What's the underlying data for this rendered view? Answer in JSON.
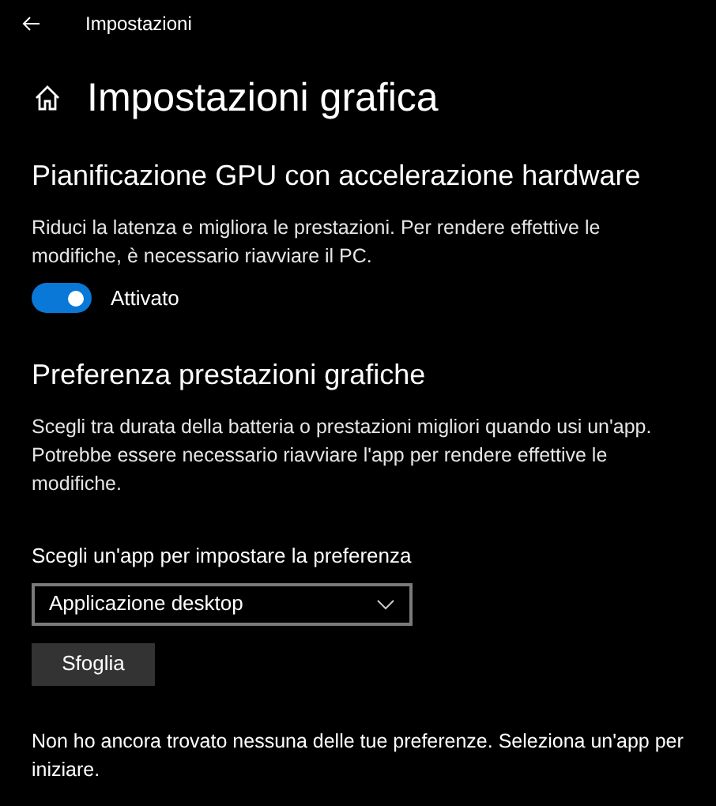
{
  "window": {
    "title": "Impostazioni"
  },
  "page": {
    "title": "Impostazioni grafica"
  },
  "sections": [
    {
      "heading": "Pianificazione GPU con accelerazione hardware",
      "description": "Riduci la latenza e migliora le prestazioni. Per rendere effettive le modifiche, è necessario riavviare il PC.",
      "toggle": {
        "on": true,
        "label": "Attivato"
      }
    },
    {
      "heading": "Preferenza prestazioni grafiche",
      "description": "Scegli tra durata della batteria o prestazioni migliori quando usi un'app. Potrebbe essere necessario riavviare l'app per rendere effettive le modifiche.",
      "field_label": "Scegli un'app per impostare la preferenza",
      "dropdown": {
        "value": "Applicazione desktop"
      },
      "button": "Sfoglia",
      "note": "Non ho ancora trovato nessuna delle tue preferenze. Seleziona un'app per iniziare."
    }
  ]
}
